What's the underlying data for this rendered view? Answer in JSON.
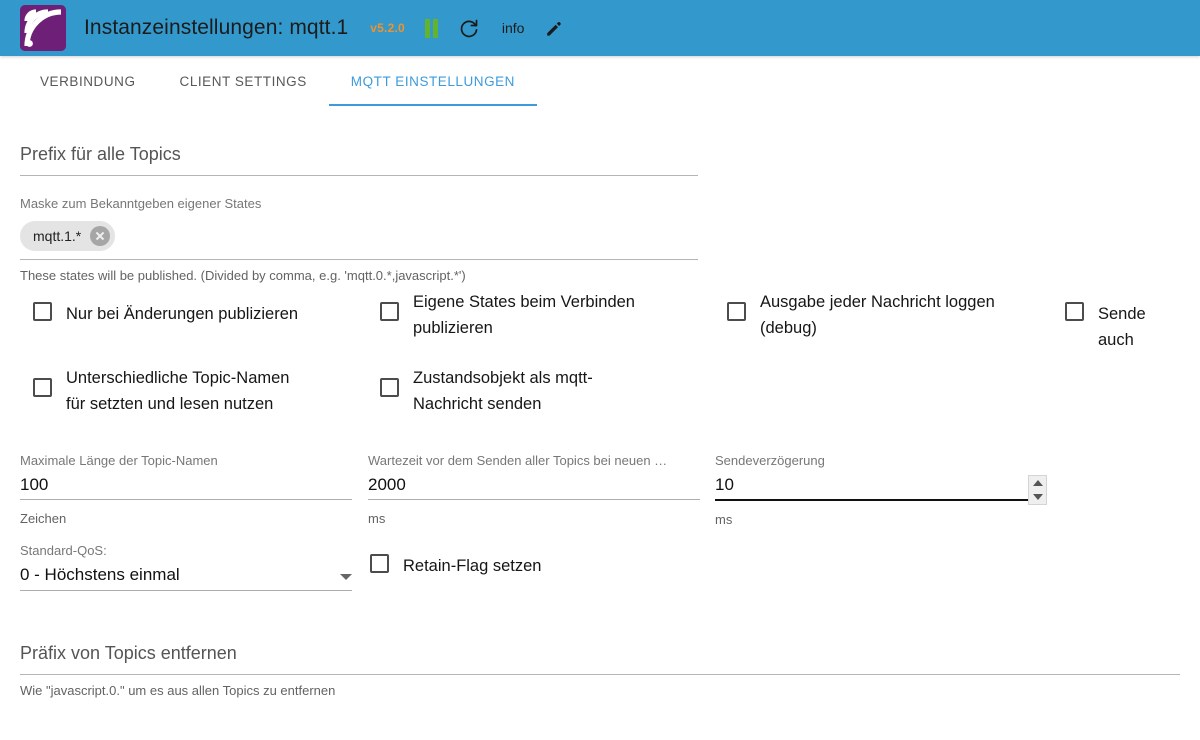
{
  "header": {
    "logo_icon": "iobroker-logo-icon",
    "title": "Instanzeinstellungen: mqtt.1",
    "version": "v5.2.0",
    "version_color": "#f0922b",
    "pause_icon": "pause-icon",
    "pause_color": "#63b32e",
    "refresh_icon": "refresh-icon",
    "info_label": "info",
    "edit_icon": "pencil-edit-icon",
    "background_color": "#3399cc"
  },
  "tabs": [
    {
      "label": "VERBINDUNG",
      "active": false
    },
    {
      "label": "CLIENT SETTINGS",
      "active": false
    },
    {
      "label": "MQTT EINSTELLUNGEN",
      "active": true
    }
  ],
  "accent_color": "#3d9bdc",
  "prefix_section": {
    "title": "Prefix für alle Topics",
    "mask_label": "Maske zum Bekanntgeben eigener States",
    "chips": [
      {
        "text": "mqtt.1.*",
        "remove_icon": "chip-remove-icon"
      }
    ],
    "helper": "These states will be published. (Divided by comma, e.g. 'mqtt.0.*,javascript.*')"
  },
  "checkboxes_row1": [
    {
      "label": "Nur bei Änderungen publizieren",
      "checked": false
    },
    {
      "label": "Eigene States beim Verbinden\npublizieren",
      "checked": false
    },
    {
      "label": "Ausgabe jeder Nachricht loggen\n(debug)",
      "checked": false
    },
    {
      "label": "Sende auch",
      "checked": false
    }
  ],
  "checkboxes_row2": [
    {
      "label": "Unterschiedliche Topic-Namen\nfür setzten und lesen nutzen",
      "checked": false
    },
    {
      "label": "Zustandsobjekt als mqtt-\nNachricht senden",
      "checked": false
    }
  ],
  "inputs": [
    {
      "label": "Maximale Länge der Topic-Namen",
      "value": "100",
      "help": "Zeichen",
      "focused": false,
      "spinner": false
    },
    {
      "label": "Wartezeit vor dem Senden aller Topics bei neuen …",
      "value": "2000",
      "help": "ms",
      "focused": false,
      "spinner": false
    },
    {
      "label": "Sendeverzögerung",
      "value": "10",
      "help": "ms",
      "focused": true,
      "spinner": true
    }
  ],
  "qos": {
    "label": "Standard-QoS:",
    "value": "0 - Höchstens einmal",
    "caret_icon": "chevron-down-icon"
  },
  "retain": {
    "label": "Retain-Flag setzen",
    "checked": false
  },
  "remove_prefix_section": {
    "title": "Präfix von Topics entfernen",
    "helper": "Wie \"javascript.0.\" um es aus allen Topics zu entfernen"
  }
}
